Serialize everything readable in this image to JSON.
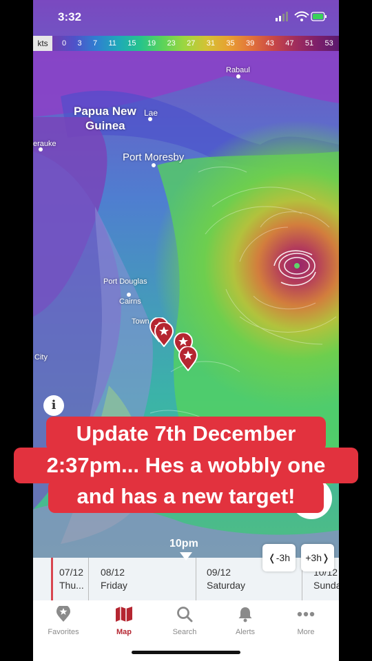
{
  "status": {
    "time": "3:32"
  },
  "legend": {
    "unit": "kts",
    "values": [
      "0",
      "3",
      "7",
      "11",
      "15",
      "19",
      "23",
      "27",
      "31",
      "35",
      "39",
      "43",
      "47",
      "51",
      "53"
    ]
  },
  "map": {
    "places": {
      "rabaul": "Rabaul",
      "png": "Papua New",
      "guinea": "Guinea",
      "lae": "Lae",
      "erauke": "erauke",
      "port_moresby": "Port Moresby",
      "port_douglas": "Port Douglas",
      "cairns": "Cairns",
      "townsville": "Town",
      "city": "City"
    }
  },
  "caption": {
    "line1": "Update 7th December",
    "line2": "2:37pm... Hes a wobbly one",
    "line3": "and has a new target!"
  },
  "timeline": {
    "current_time": "10pm",
    "days": [
      {
        "date": "07/12",
        "day": "Thu..."
      },
      {
        "date": "08/12",
        "day": "Friday"
      },
      {
        "date": "09/12",
        "day": "Saturday"
      },
      {
        "date": "10/12",
        "day": "Sunda"
      }
    ],
    "back_label": "-3h",
    "forward_label": "+3h"
  },
  "tabs": [
    {
      "label": "Favorites",
      "icon": "favorites-star-pin-icon"
    },
    {
      "label": "Map",
      "icon": "map-icon",
      "active": true
    },
    {
      "label": "Search",
      "icon": "search-icon"
    },
    {
      "label": "Alerts",
      "icon": "bell-icon"
    },
    {
      "label": "More",
      "icon": "more-dots-icon"
    }
  ],
  "colors": {
    "accent": "#b52631",
    "caption_bg": "#e2323e"
  }
}
